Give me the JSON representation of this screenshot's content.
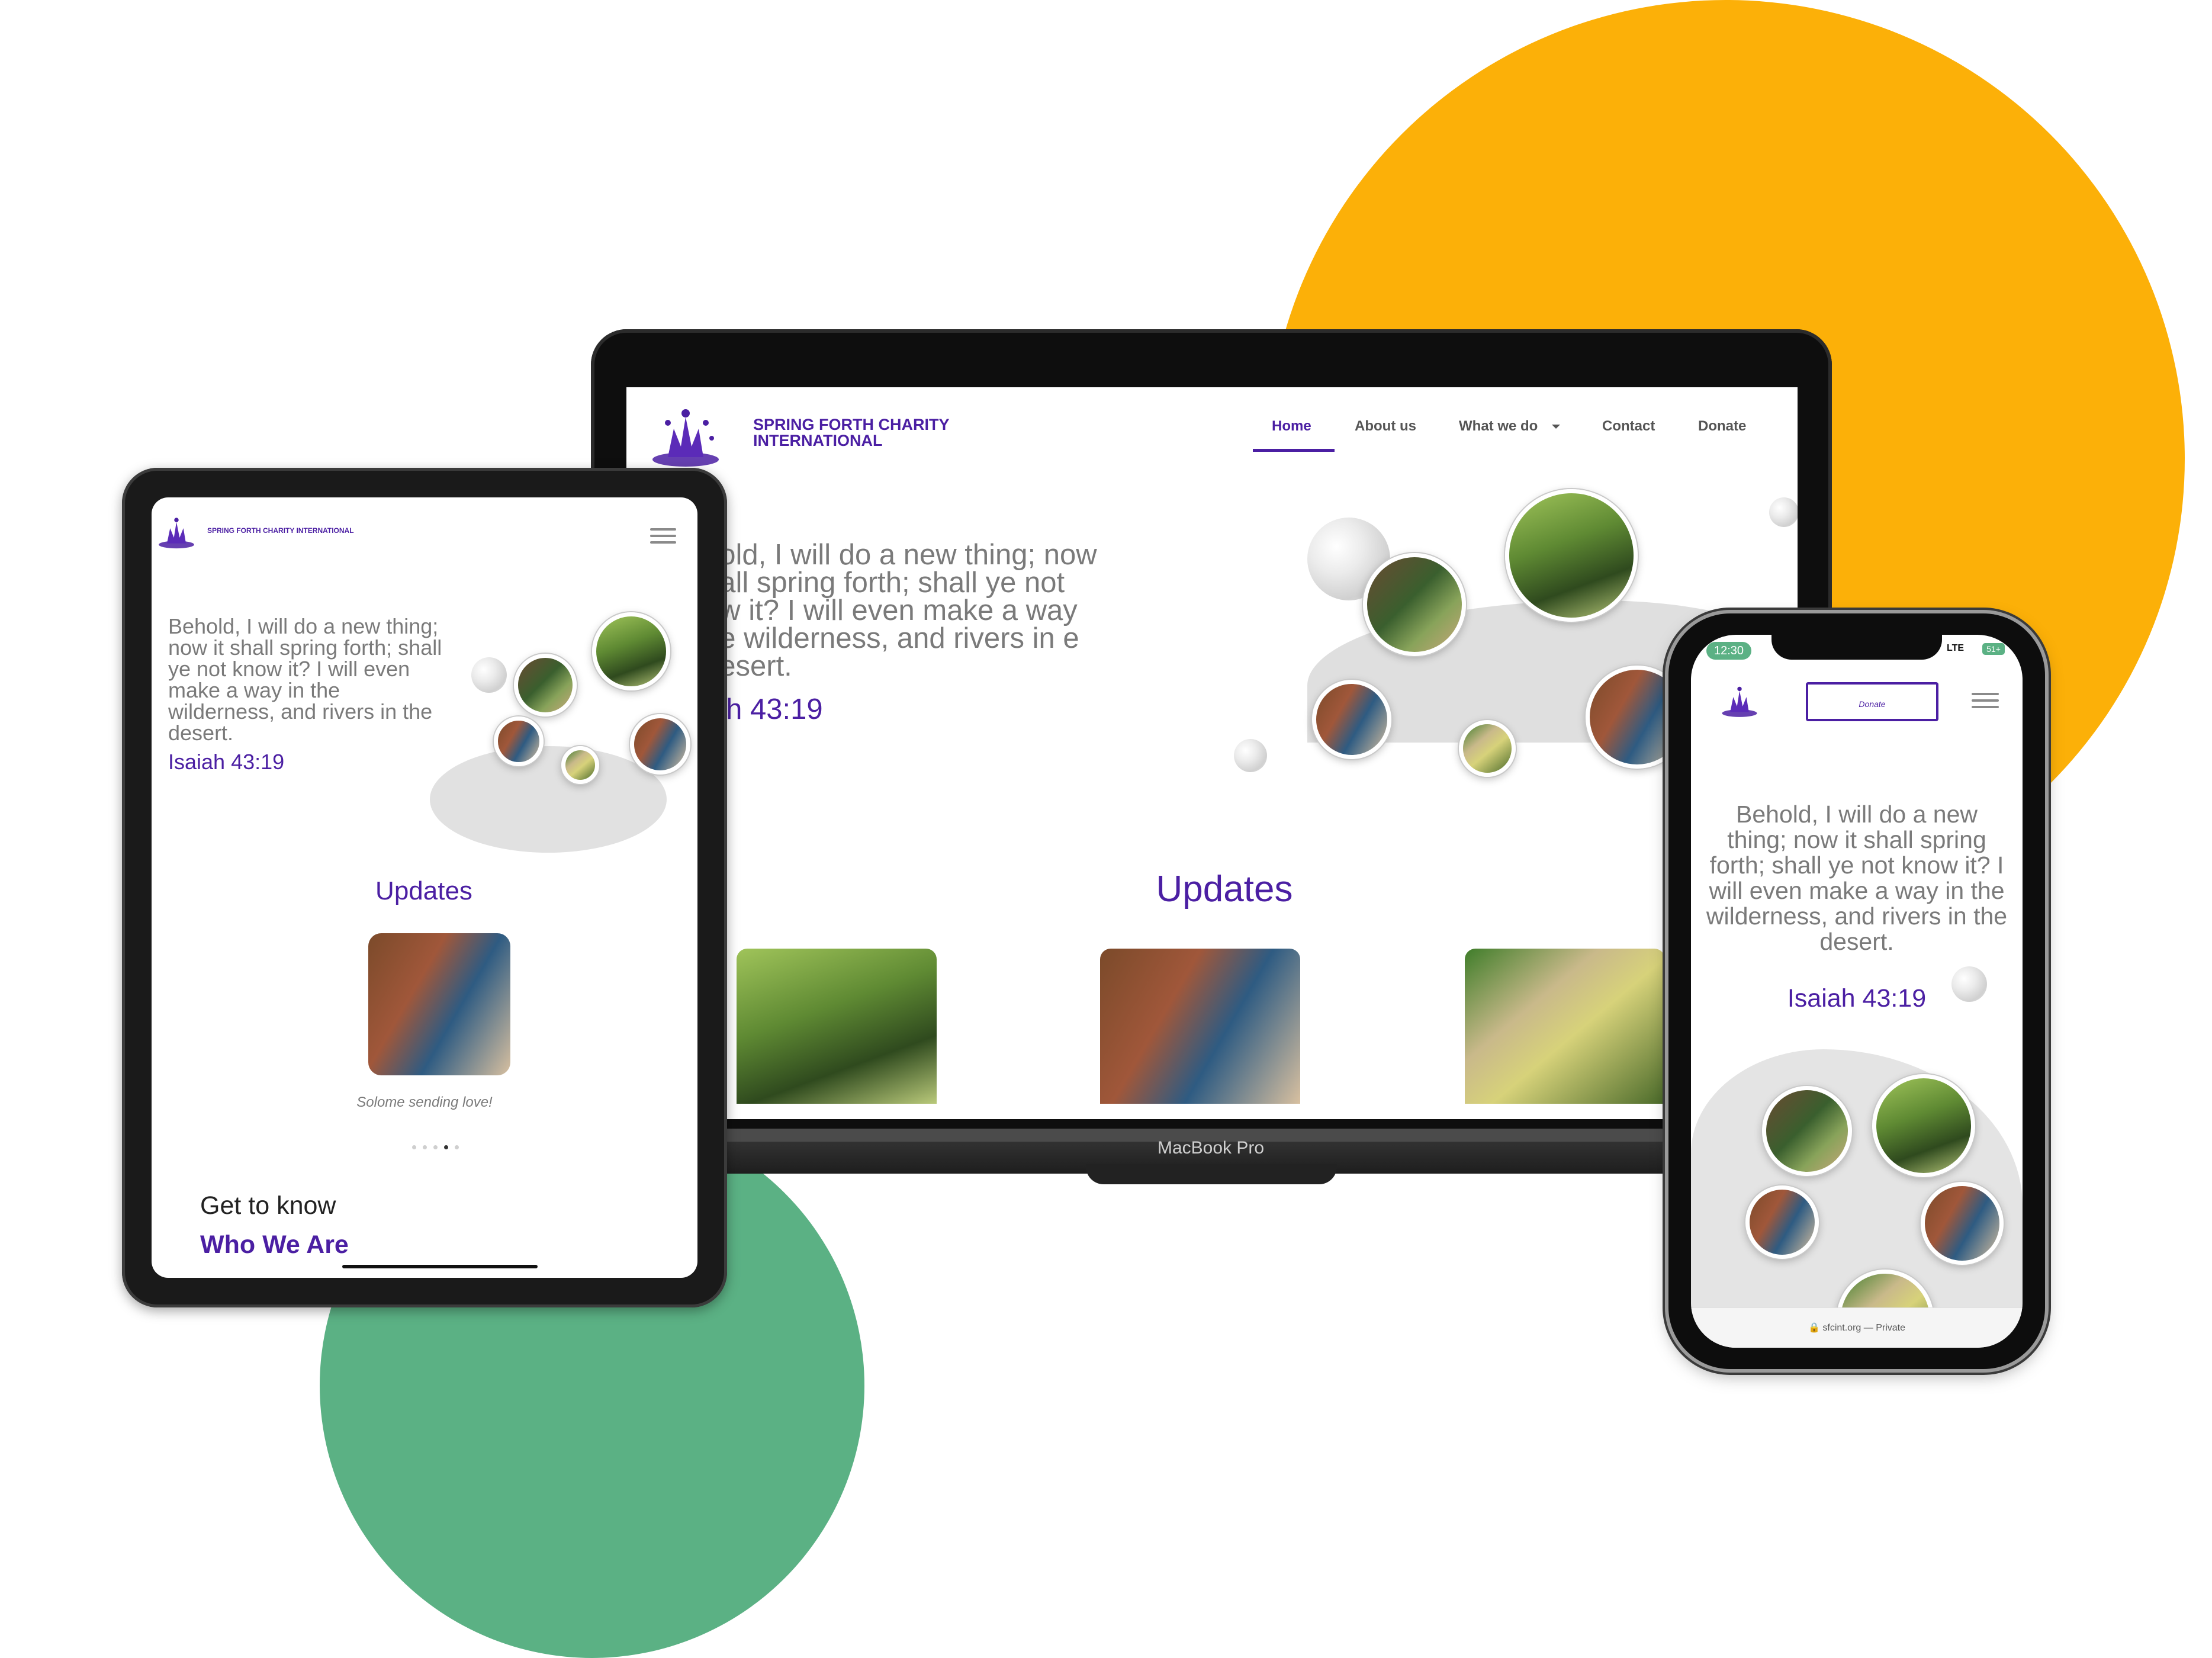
{
  "brand": {
    "name": "SPRING FORTH CHARITY INTERNATIONAL",
    "accent": "#4B1FA3",
    "yellow": "#FCB008",
    "green": "#5BB184"
  },
  "laptop": {
    "label": "MacBook Pro",
    "nav": [
      {
        "label": "Home",
        "active": true
      },
      {
        "label": "About us",
        "active": false
      },
      {
        "label": "What we do",
        "active": false,
        "dropdown": true
      },
      {
        "label": "Contact",
        "active": false
      },
      {
        "label": "Donate",
        "active": false
      }
    ],
    "hero": {
      "quote": "hold, I will do a new thing; now hall spring forth; shall ye not ow it? I will even make a way he wilderness, and rivers in e desert.",
      "verse": "iah 43:19"
    },
    "updates_title": "Updates"
  },
  "tablet": {
    "hero": {
      "quote": "Behold, I will do a new thing; now it shall spring forth; shall ye not know it? I will even make a way in the wilderness, and rivers in the desert.",
      "verse": "Isaiah 43:19"
    },
    "updates_title": "Updates",
    "caption": "Solome sending love!",
    "carousel_total": 5,
    "carousel_active": 4,
    "section_intro": "Get to know",
    "section_title": "Who We Are"
  },
  "phone": {
    "status": {
      "time": "12:30",
      "network": "LTE",
      "battery": "51+"
    },
    "donate_label": "Donate",
    "hero": {
      "quote": "Behold, I will do a new thing; now it shall spring forth; shall ye not know it? I will even make a way in the wilderness, and rivers in the desert.",
      "verse": "Isaiah 43:19"
    },
    "url": "sfcint.org",
    "url_suffix": "— Private"
  },
  "icons": [
    "logo-icon",
    "menu-icon",
    "chevron-down-icon",
    "lock-icon"
  ]
}
